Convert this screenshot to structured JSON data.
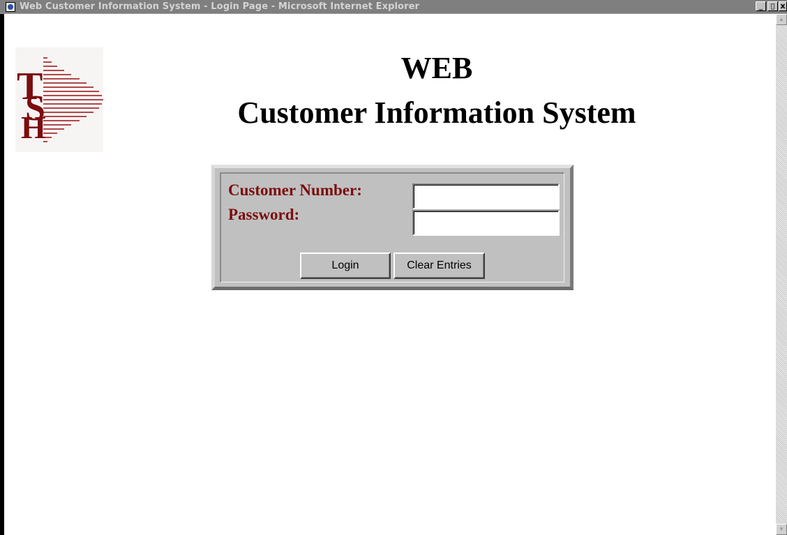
{
  "window": {
    "title": "Web Customer Information System - Login Page - Microsoft Internet Explorer",
    "minimize_glyph": "_",
    "maximize_glyph": "▯",
    "close_glyph": "x",
    "app_icon": "internet-explorer-icon"
  },
  "scrollbar": {
    "up_glyph": "▲",
    "down_glyph": "▼"
  },
  "logo": {
    "text": "TSH",
    "name": "tsh-logo",
    "colors": {
      "letters": "#7b0d0d",
      "stripes": "#a03a3a"
    }
  },
  "header": {
    "line1": "WEB",
    "line2": "Customer Information System"
  },
  "login_form": {
    "customer_label": "Customer Number:",
    "customer_value": "",
    "password_label": "Password:",
    "password_value": "",
    "login_button": "Login",
    "clear_button": "Clear Entries",
    "label_color": "#7b0d0d"
  }
}
